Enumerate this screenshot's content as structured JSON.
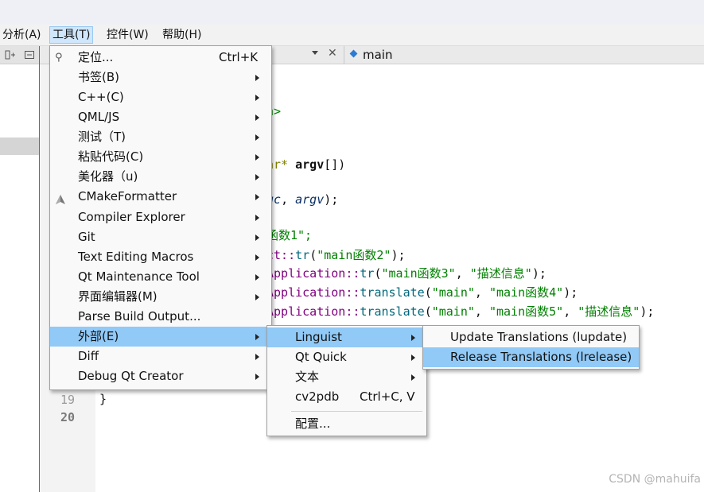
{
  "menubar": {
    "analyze": "分析(A)",
    "tools": "工具(T)",
    "controls": "控件(W)",
    "help": "帮助(H)"
  },
  "editor_tab": {
    "filename": "main"
  },
  "gutter": {
    "lines": [
      "19",
      "20"
    ]
  },
  "code_lines": {
    "l1": "n>",
    "l2a": "ar* ",
    "l2b": "argv",
    "l2c": "[])",
    "l3a": "gc",
    "l3b": ", ",
    "l3c": "argv",
    "l3d": ");",
    "l4": "函数1\";",
    "l5a": "ct::",
    "l5b": "tr",
    "l5c": "(",
    "l5d": "\"main函数2\"",
    "l5e": ");",
    "l6a": "Application::",
    "l6b": "tr",
    "l6c": "(",
    "l6d": "\"main函数3\"",
    "l6e": ", ",
    "l6f": "\"描述信息\"",
    "l6g": ");",
    "l7a": "Application::",
    "l7b": "translate",
    "l7c": "(",
    "l7d": "\"main\"",
    "l7e": ", ",
    "l7f": "\"main函数4\"",
    "l7g": ");",
    "l8a": "Application::",
    "l8b": "translate",
    "l8c": "(",
    "l8d": "\"main\"",
    "l8e": ", ",
    "l8f": "\"main函数5\"",
    "l8g": ", ",
    "l8h": "\"描述信息\"",
    "l8i": ");",
    "l9": "}"
  },
  "tools_menu": {
    "locate": "定位...",
    "locate_shortcut": "Ctrl+K",
    "bookmarks": "书签(B)",
    "cpp": "C++(C)",
    "qmljs": "QML/JS",
    "test": "测试（T)",
    "paste_code": "粘贴代码(C)",
    "beautifier": "美化器（u)",
    "cmakeformatter": "CMakeFormatter",
    "compiler_explorer": "Compiler Explorer",
    "git": "Git",
    "text_editing_macros": "Text Editing Macros",
    "qt_maintenance_tool": "Qt Maintenance Tool",
    "ui_editor": "界面编辑器(M)",
    "parse_build_output": "Parse Build Output...",
    "external": "外部(E)",
    "diff": "Diff",
    "debug_qt_creator": "Debug Qt Creator"
  },
  "external_menu": {
    "linguist": "Linguist",
    "qt_quick": "Qt Quick",
    "text": "文本",
    "cv2pdb": "cv2pdb",
    "cv2pdb_shortcut": "Ctrl+C, V",
    "configure": "配置..."
  },
  "linguist_menu": {
    "update_translations": "Update Translations (lupdate)",
    "release_translations": "Release Translations (lrelease)"
  },
  "watermark": "CSDN @mahuifa"
}
